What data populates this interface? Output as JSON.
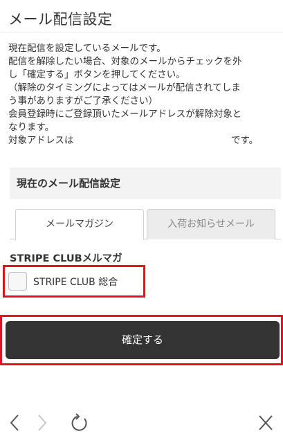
{
  "page": {
    "title": "メール配信設定"
  },
  "description": {
    "lines": [
      "現在配信を設定しているメールです。",
      "配信を解除したい場合、対象のメールからチェックを外",
      "し「確定する」ボタンを押してください。",
      "（解除のタイミングによってはメールが配信されてしま",
      "う事がありますがご了承ください）",
      "会員登録時にご登録頂いたメールアドレスが解除対象と",
      "なります。"
    ],
    "target_prefix": "対象アドレスは",
    "target_suffix": "です。"
  },
  "section": {
    "heading": "現在のメール配信設定"
  },
  "tabs": [
    {
      "label": "メールマガジン",
      "active": true
    },
    {
      "label": "入荷お知らせメール",
      "active": false
    }
  ],
  "subscriptions": {
    "group_label": "STRIPE CLUBメルマガ",
    "items": [
      {
        "label": "STRIPE CLUB 総合",
        "checked": false
      }
    ]
  },
  "actions": {
    "confirm_label": "確定する"
  },
  "browser_toolbar": {
    "icons": [
      "back-icon",
      "forward-icon",
      "reload-icon",
      "close-icon"
    ]
  },
  "colors": {
    "highlight": "#e0141e",
    "button_bg": "#333333",
    "section_bg": "#f3f3f3"
  }
}
